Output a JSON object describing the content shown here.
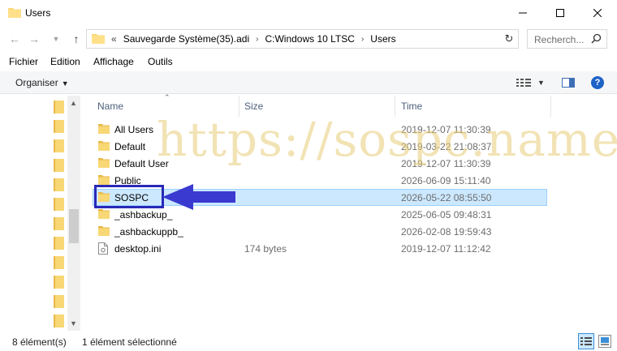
{
  "window": {
    "title": "Users"
  },
  "address": {
    "prefix": "«",
    "crumbs": [
      "Sauvegarde Système(35).adi",
      "C:Windows 10 LTSC",
      "Users"
    ]
  },
  "search": {
    "placeholder": "Recherch..."
  },
  "menu": [
    "Fichier",
    "Edition",
    "Affichage",
    "Outils"
  ],
  "toolbar": {
    "organize": "Organiser"
  },
  "columns": {
    "name": "Name",
    "size": "Size",
    "time": "Time"
  },
  "files": [
    {
      "name": "All Users",
      "size": "",
      "time": "2019-12-07 11:30:39",
      "icon": "folder-icon"
    },
    {
      "name": "Default",
      "size": "",
      "time": "2019-03-22 21:08:37",
      "icon": "folder-icon"
    },
    {
      "name": "Default User",
      "size": "",
      "time": "2019-12-07 11:30:39",
      "icon": "folder-icon"
    },
    {
      "name": "Public",
      "size": "",
      "time": "2026-06-09 15:11:40",
      "icon": "folder-icon"
    },
    {
      "name": "SOSPC",
      "size": "",
      "time": "2026-05-22 08:55:50",
      "icon": "folder-icon",
      "selected": true
    },
    {
      "name": "_ashbackup_",
      "size": "",
      "time": "2025-06-05 09:48:31",
      "icon": "folder-icon"
    },
    {
      "name": "_ashbackuppb_",
      "size": "",
      "time": "2026-02-08 19:59:43",
      "icon": "folder-icon"
    },
    {
      "name": "desktop.ini",
      "size": "174 bytes",
      "time": "2019-12-07 11:12:42",
      "icon": "file-icon"
    }
  ],
  "status": {
    "count": "8 élément(s)",
    "selection": "1 élément sélectionné"
  },
  "watermark": "https://sospc.name",
  "colors": {
    "folder": "#f8d775",
    "selection": "#cce8ff",
    "highlight": "#2929b8",
    "arrow": "#3a3ad0",
    "watermark": "#e8cc78"
  }
}
